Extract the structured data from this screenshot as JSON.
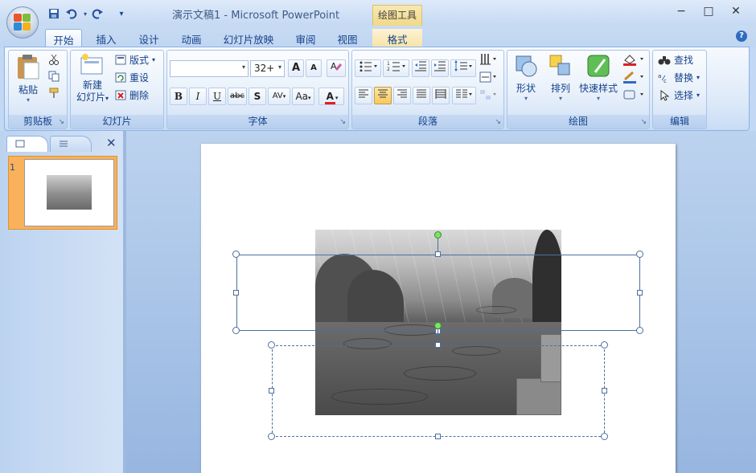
{
  "app": {
    "title": "演示文稿1 - Microsoft PowerPoint",
    "context_tab_group": "绘图工具",
    "window": {
      "minimize": "−",
      "maximize": "□",
      "close": "✕"
    }
  },
  "quick_access": {
    "save": "save-icon",
    "undo": "undo-icon",
    "redo": "redo-icon",
    "customize": "▾"
  },
  "tabs": [
    {
      "label": "开始",
      "active": true
    },
    {
      "label": "插入"
    },
    {
      "label": "设计"
    },
    {
      "label": "动画"
    },
    {
      "label": "幻灯片放映"
    },
    {
      "label": "审阅"
    },
    {
      "label": "视图"
    },
    {
      "label": "格式"
    }
  ],
  "ribbon": {
    "clipboard": {
      "label": "剪贴板",
      "paste": "粘贴",
      "cut": "cut-icon",
      "copy": "copy-icon",
      "format_painter": "format-painter-icon"
    },
    "slides": {
      "label": "幻灯片",
      "new_slide_line1": "新建",
      "new_slide_line2": "幻灯片",
      "layout": "版式",
      "reset": "重设",
      "delete": "删除"
    },
    "font": {
      "label": "字体",
      "font_name": "",
      "font_size": "32+",
      "grow": "A",
      "shrink": "A",
      "clear": "clear-formatting-icon",
      "bold": "B",
      "italic": "I",
      "underline": "U",
      "strike": "abc",
      "shadow": "S",
      "spacing": "AV",
      "case": "Aa",
      "color": "A",
      "font_color_hex": "#e02020"
    },
    "paragraph": {
      "label": "段落"
    },
    "drawing": {
      "label": "绘图",
      "shapes": "形状",
      "arrange": "排列",
      "quick_styles": "快速样式"
    },
    "editing": {
      "label": "编辑",
      "find": "查找",
      "replace": "替换",
      "select": "选择"
    }
  },
  "slides_pane": {
    "slide_number": "1"
  },
  "colors": {
    "accent": "#15428b",
    "ribbon_border": "#8db2e3",
    "context_tab": "#f1d889",
    "thumb_selected": "#f9b15c"
  }
}
